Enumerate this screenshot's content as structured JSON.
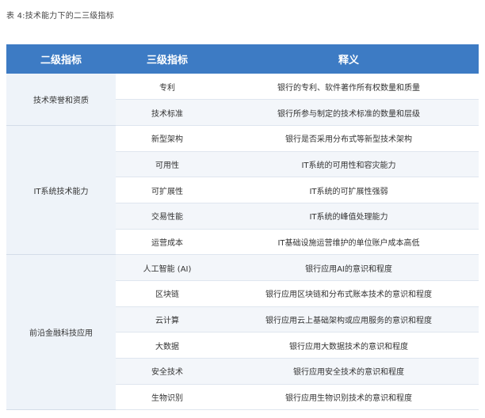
{
  "caption": "表 4:技术能力下的二三级指标",
  "headers": [
    "二级指标",
    "三级指标",
    "释义"
  ],
  "groups": [
    {
      "name": "技术荣誉和资质",
      "rows": [
        {
          "sub": "专利",
          "desc": "银行的专利、软件著作所有权数量和质量"
        },
        {
          "sub": "技术标准",
          "desc": "银行所参与制定的技术标准的数量和层级"
        }
      ]
    },
    {
      "name": "IT系统技术能力",
      "rows": [
        {
          "sub": "新型架构",
          "desc": "银行是否采用分布式等新型技术架构"
        },
        {
          "sub": "可用性",
          "desc": "IT系统的可用性和容灾能力"
        },
        {
          "sub": "可扩展性",
          "desc": "IT系统的可扩展性强弱"
        },
        {
          "sub": "交易性能",
          "desc": "IT系统的峰值处理能力"
        },
        {
          "sub": "运营成本",
          "desc": "IT基础设施运营维护的单位账户成本高低"
        }
      ]
    },
    {
      "name": "前沿金融科技应用",
      "rows": [
        {
          "sub": "人工智能 (AI)",
          "desc": "银行应用AI的意识和程度"
        },
        {
          "sub": "区块链",
          "desc": "银行应用区块链和分布式账本技术的意识和程度"
        },
        {
          "sub": "云计算",
          "desc": "银行应用云上基础架构或应用服务的意识和程度"
        },
        {
          "sub": "大数据",
          "desc": "银行应用大数据技术的意识和程度"
        },
        {
          "sub": "安全技术",
          "desc": "银行应用安全技术的意识和程度"
        },
        {
          "sub": "生物识别",
          "desc": "银行应用生物识别技术的意识和程度"
        }
      ]
    }
  ]
}
